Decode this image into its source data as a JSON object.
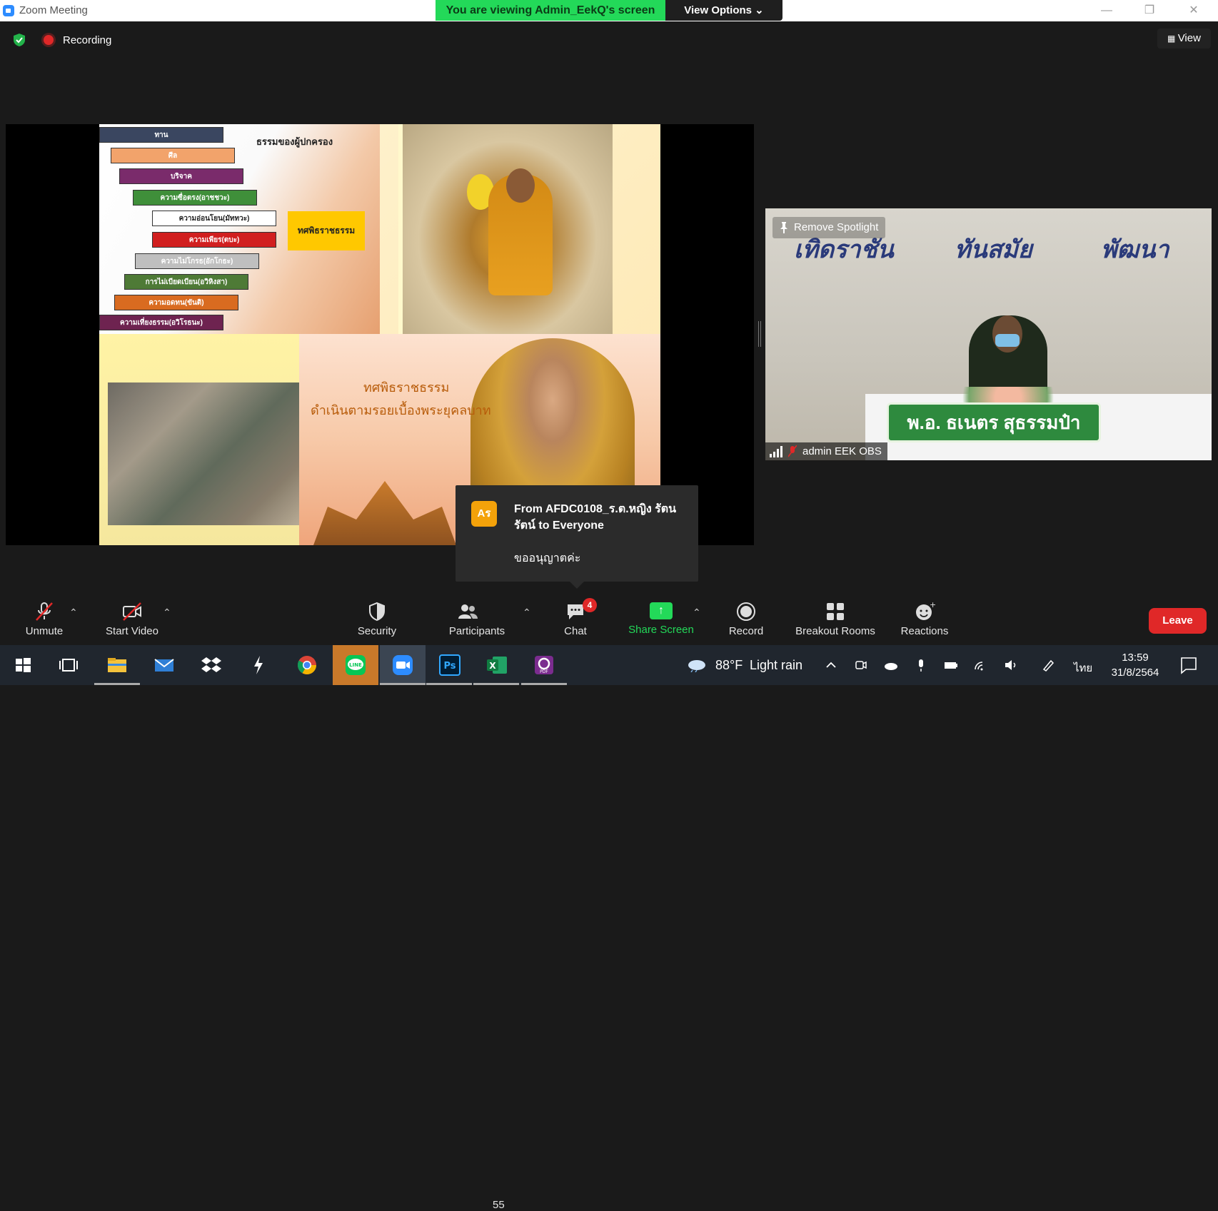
{
  "window": {
    "title": "Zoom Meeting",
    "viewing_banner": "You are viewing Admin_EekQ's screen",
    "view_options": "View Options ⌄",
    "minimize": "—",
    "restore": "❐",
    "close": "✕"
  },
  "topbar": {
    "recording_label": "Recording",
    "view_label": "View"
  },
  "slide": {
    "heading": "ธรรมของผู้ปกครอง",
    "bars": [
      {
        "label": "ทาน",
        "color": "#3a4660"
      },
      {
        "label": "ศีล",
        "color": "#f2a36b"
      },
      {
        "label": "บริจาค",
        "color": "#7a2b6b"
      },
      {
        "label": "ความซื่อตรง(อาชชวะ)",
        "color": "#3f8f3a"
      },
      {
        "label": "ความอ่อนโยน(มัททวะ)",
        "color": "#ffffff"
      },
      {
        "label": "ความเพียร(ตบะ)",
        "color": "#d11f1f"
      },
      {
        "label": "ความไม่โกรธ(อักโกธะ)",
        "color": "#bfbfbf"
      },
      {
        "label": "การไม่เบียดเบียน(อวิหิงสา)",
        "color": "#4e7a36"
      },
      {
        "label": "ความอดทน(ขันติ)",
        "color": "#d96b20"
      },
      {
        "label": "ความเที่ยงธรรม(อวิโรธนะ)",
        "color": "#6e2350"
      }
    ],
    "yellow_box": "ทศพิธราชธรรม",
    "caption_1": "ทศพิธราชธรรม",
    "caption_2": "ดำเนินตามรอยเบื้องพระยุคลบาท"
  },
  "speaker": {
    "remove_spotlight": "Remove Spotlight",
    "banner_words": [
      "เทิดราชัน",
      "ทันสมัย",
      "พัฒนา"
    ],
    "nameplate": "พ.อ. ธเนตร สุธรรมป๋า",
    "name": "admin EEK OBS"
  },
  "chat_toast": {
    "avatar": "Aร",
    "from": "From AFDC0108_ร.ต.หญิง รัตนรัตน์ to Everyone",
    "message": "ขออนุญาตค่ะ"
  },
  "toolbar": {
    "unmute": "Unmute",
    "start_video": "Start Video",
    "security": "Security",
    "participants": "Participants",
    "participant_count": "55",
    "chat": "Chat",
    "chat_badge": "4",
    "share_screen": "Share Screen",
    "record": "Record",
    "breakout_rooms": "Breakout Rooms",
    "reactions": "Reactions",
    "leave": "Leave",
    "caret": "⌃"
  },
  "taskbar": {
    "weather_temp": "88°F",
    "weather_text": "Light rain",
    "language": "ไทย",
    "time": "13:59",
    "date": "31/8/2564"
  },
  "colors": {
    "zoom_blue": "#2d8cff",
    "banner_green": "#23d959",
    "leave_red": "#e02828"
  }
}
